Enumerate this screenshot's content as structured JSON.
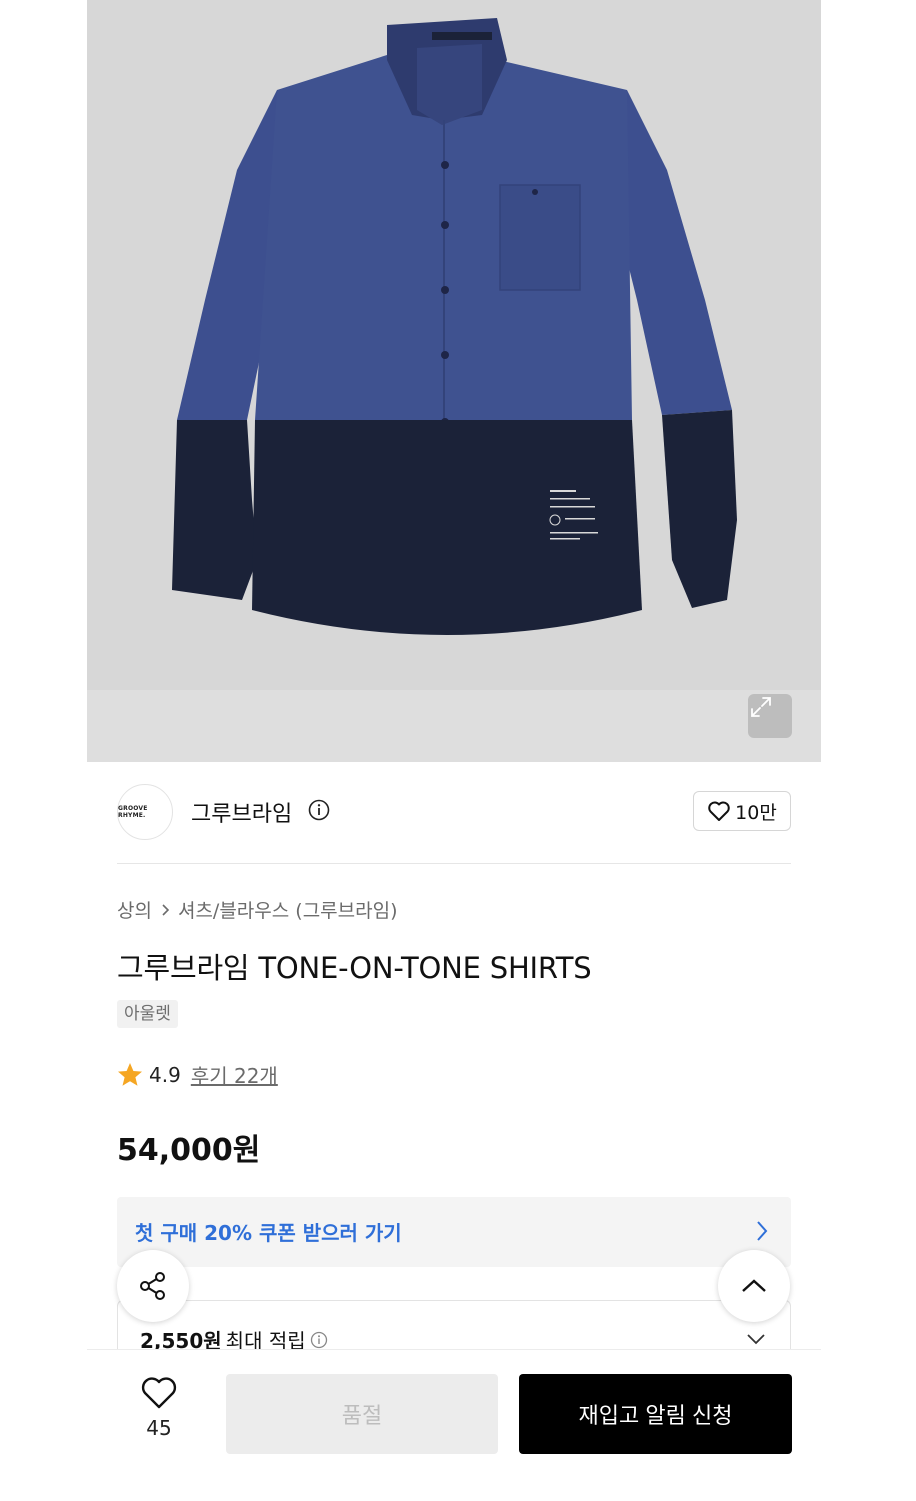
{
  "product_image": {
    "alt": "Navy tone-on-tone shirt"
  },
  "brand": {
    "logo_text": "GROOVE RHYME.",
    "name": "그루브라임",
    "likes": "10만"
  },
  "breadcrumb": {
    "category": "상의",
    "subcategory": "셔츠/블라우스 (그루브라임)"
  },
  "product": {
    "title": "그루브라임 TONE-ON-TONE SHIRTS",
    "tag": "아울렛",
    "rating": "4.9",
    "reviews": "후기 22개",
    "price": "54,000원"
  },
  "coupon": {
    "text": "첫 구매 20% 쿠폰 받으러 가기"
  },
  "points": {
    "amount": "2,550원",
    "label": "최대 적립"
  },
  "bottom": {
    "wish_count": "45",
    "soldout_label": "품절",
    "restock_label": "재입고 알림 신청"
  },
  "colors": {
    "accent_blue": "#2f6fd8",
    "star": "#f5a623",
    "shirt_blue": "#3d4f8f",
    "shirt_navy": "#1b2238"
  },
  "icons": [
    "expand-icon",
    "info-icon",
    "heart-icon",
    "chevron-right-icon",
    "star-icon",
    "share-icon",
    "chevron-up-icon",
    "chevron-down-icon"
  ]
}
